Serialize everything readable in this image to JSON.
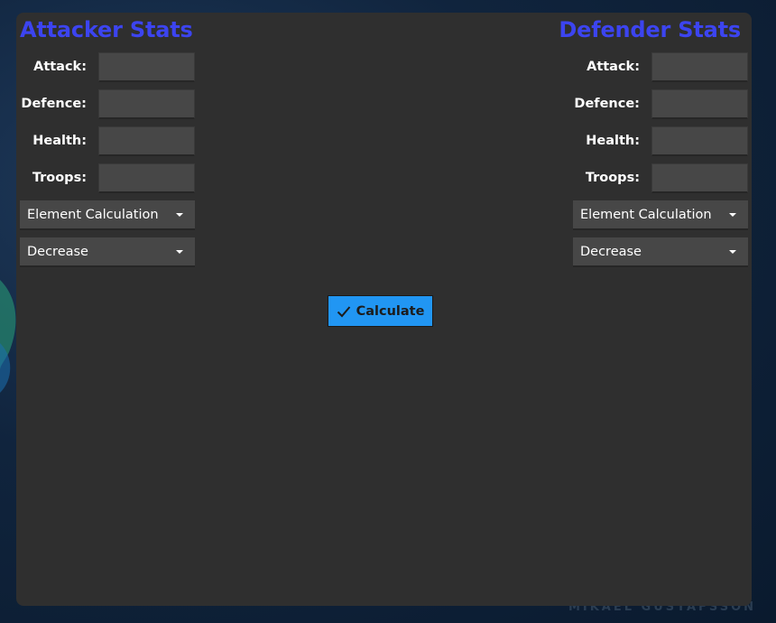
{
  "watermark": "MIKAEL GUSTAFSSON",
  "attacker": {
    "title": "Attacker Stats",
    "fields": [
      {
        "label": "Attack:",
        "value": ""
      },
      {
        "label": "Defence:",
        "value": ""
      },
      {
        "label": "Health:",
        "value": ""
      },
      {
        "label": "Troops:",
        "value": ""
      }
    ],
    "element_dropdown": "Element Calculation",
    "mode_dropdown": "Decrease"
  },
  "defender": {
    "title": "Defender Stats",
    "fields": [
      {
        "label": "Attack:",
        "value": ""
      },
      {
        "label": "Defence:",
        "value": ""
      },
      {
        "label": "Health:",
        "value": ""
      },
      {
        "label": "Troops:",
        "value": ""
      }
    ],
    "element_dropdown": "Element Calculation",
    "mode_dropdown": "Decrease"
  },
  "calculate": {
    "label": "Calculate",
    "icon": "check-icon"
  },
  "colors": {
    "title": "#3c44f0",
    "accent": "#2196f3",
    "panel": "#2f2f2f",
    "field": "#474747"
  }
}
